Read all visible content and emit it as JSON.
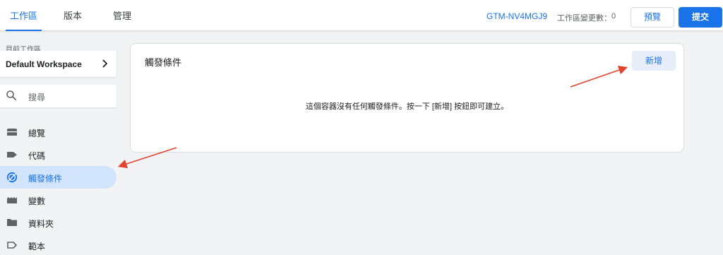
{
  "header": {
    "tabs": [
      {
        "label": "工作區"
      },
      {
        "label": "版本"
      },
      {
        "label": "管理"
      }
    ],
    "container_id": "GTM-NV4MGJ9",
    "changes_label": "工作區變更數：",
    "changes_count": "0",
    "preview_label": "預覽",
    "submit_label": "提交"
  },
  "sidebar": {
    "workspace_label": "目前工作區",
    "workspace_name": "Default Workspace",
    "search_placeholder": "搜尋",
    "items": [
      {
        "label": "總覽",
        "icon": "overview-icon"
      },
      {
        "label": "代碼",
        "icon": "tag-icon"
      },
      {
        "label": "觸發條件",
        "icon": "trigger-icon"
      },
      {
        "label": "變數",
        "icon": "variables-icon"
      },
      {
        "label": "資料夾",
        "icon": "folder-icon"
      },
      {
        "label": "範本",
        "icon": "template-icon"
      }
    ],
    "active_item": "觸發條件"
  },
  "main": {
    "card_title": "觸發條件",
    "new_button_label": "新增",
    "empty_message": "這個容器沒有任何觸發條件。按一下 [新增] 按鈕即可建立。"
  },
  "colors": {
    "accent": "#1a73e8",
    "active_nav_bg": "#d2e3fc",
    "annotation_arrow": "#e0442f"
  }
}
